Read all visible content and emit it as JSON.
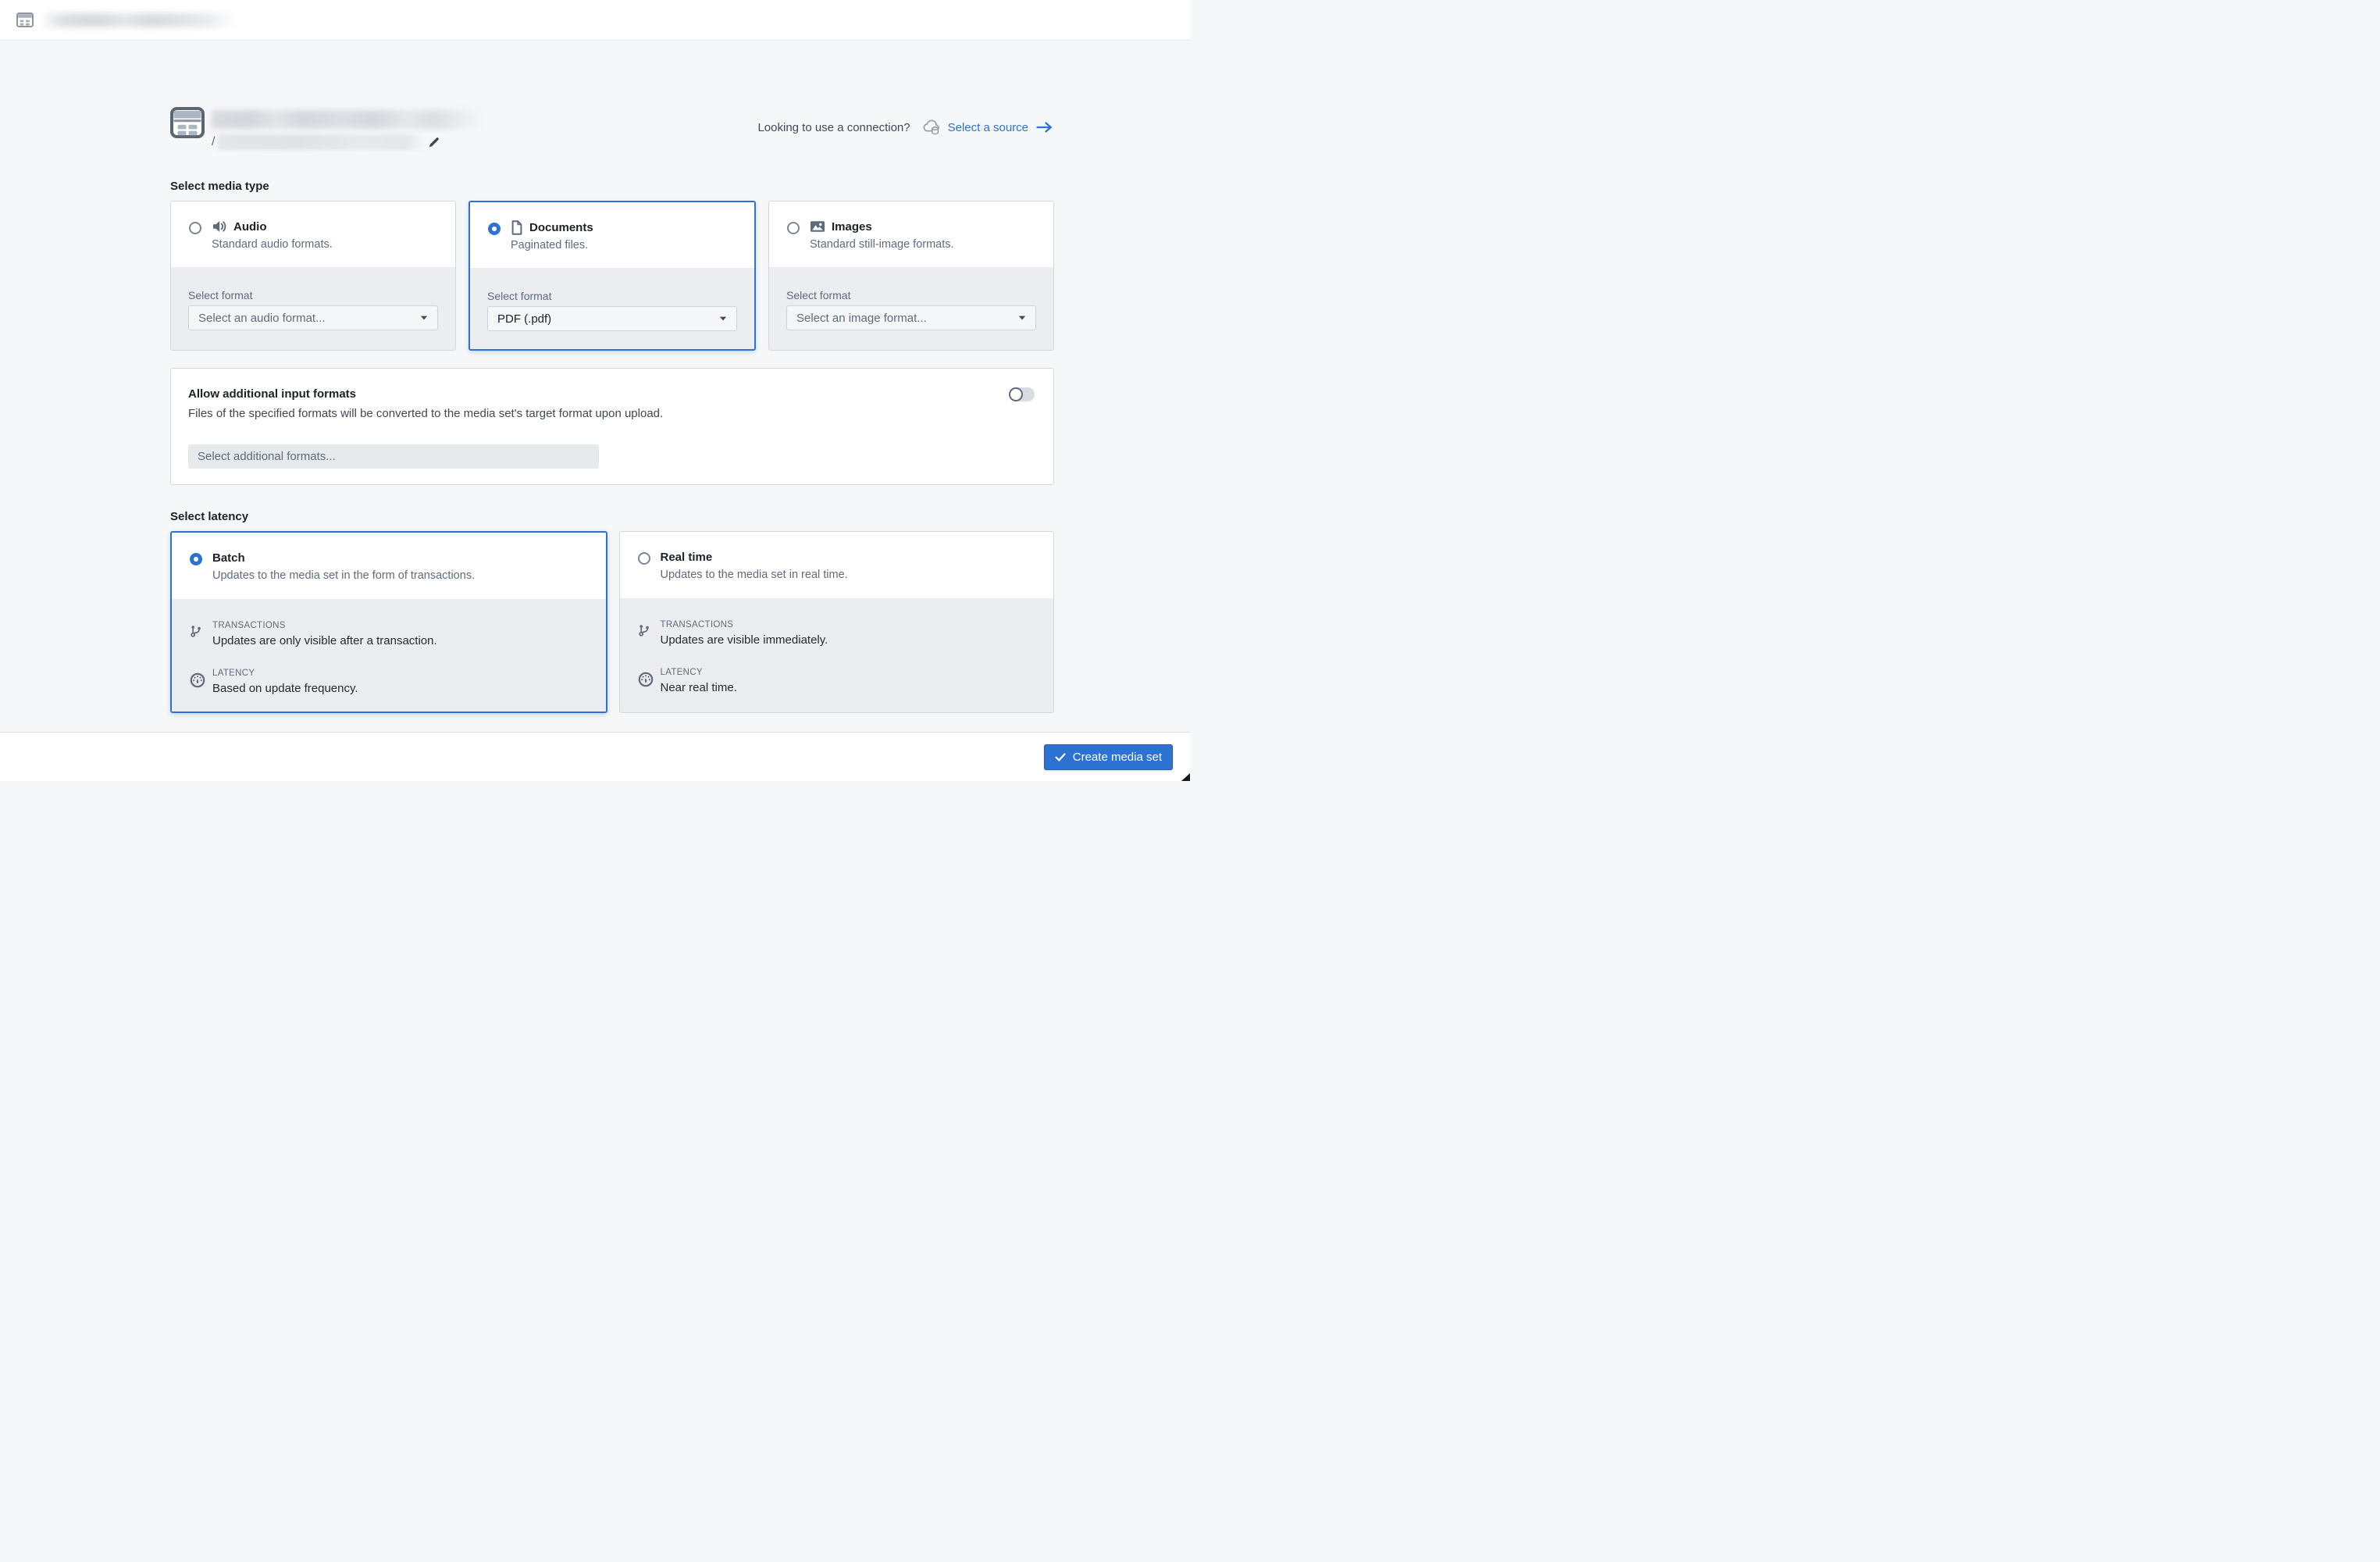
{
  "topbar": {
    "app_icon": "media-set-icon"
  },
  "header": {
    "icon": "media-set-icon",
    "path_prefix": "/",
    "connection_prompt": "Looking to use a connection?",
    "source_link": "Select a source",
    "icons": {
      "connection": "cloud-database-icon",
      "link_arrow": "arrow-right-icon",
      "edit": "pencil-icon"
    }
  },
  "media_type": {
    "label": "Select media type",
    "format_label": "Select format",
    "cards": [
      {
        "title": "Audio",
        "description": "Standard audio formats.",
        "icon": "volume-icon",
        "selected": false,
        "format_value": "Select an audio format...",
        "is_placeholder": true
      },
      {
        "title": "Documents",
        "description": "Paginated files.",
        "icon": "document-icon",
        "selected": true,
        "format_value": "PDF (.pdf)",
        "is_placeholder": false
      },
      {
        "title": "Images",
        "description": "Standard still-image formats.",
        "icon": "image-icon",
        "selected": false,
        "format_value": "Select an image format...",
        "is_placeholder": true
      }
    ]
  },
  "additional_formats": {
    "title": "Allow additional input formats",
    "description": "Files of the specified formats will be converted to the media set's target format upon upload.",
    "input_placeholder": "Select additional formats...",
    "toggle_on": false
  },
  "latency": {
    "label": "Select latency",
    "cards": [
      {
        "title": "Batch",
        "description": "Updates to the media set in the form of transactions.",
        "selected": true,
        "transactions_label": "TRANSACTIONS",
        "transactions_text": "Updates are only visible after a transaction.",
        "latency_label": "LATENCY",
        "latency_text": "Based on update frequency.",
        "icons": {
          "transactions": "git-branch-icon",
          "latency": "gauge-icon"
        }
      },
      {
        "title": "Real time",
        "description": "Updates to the media set in real time.",
        "selected": false,
        "transactions_label": "TRANSACTIONS",
        "transactions_text": "Updates are visible immediately.",
        "latency_label": "LATENCY",
        "latency_text": "Near real time.",
        "icons": {
          "transactions": "git-branch-icon",
          "latency": "gauge-icon"
        }
      }
    ]
  },
  "footer": {
    "create_button": "Create media set",
    "icon": "check-icon"
  },
  "colors": {
    "accent": "#2D72D2",
    "page_bg": "#F6F7F9",
    "card_border": "#D4D8DE",
    "gray_section": "#EBEDF0",
    "text_dark": "#1C2127",
    "text_muted": "#5F6B7C"
  }
}
